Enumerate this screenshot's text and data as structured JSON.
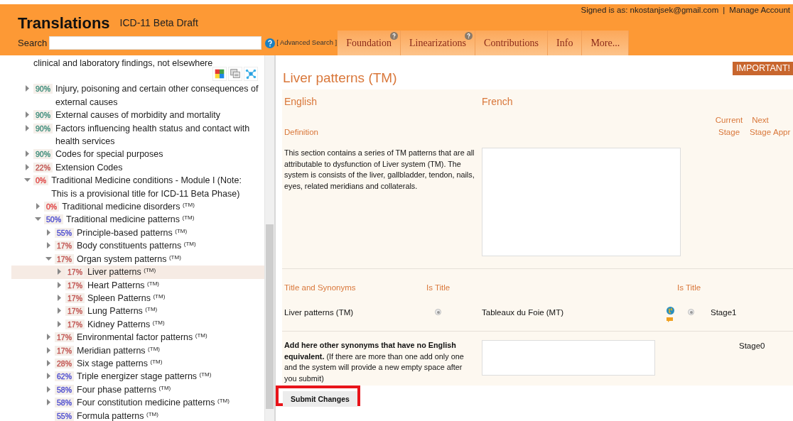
{
  "header": {
    "title": "Translations",
    "subtitle": "ICD-11 Beta Draft",
    "signed_in": "Signed is as: nkostanjsek@gmail.com",
    "separator": "|",
    "manage_account": "Manage Account",
    "search_label": "Search",
    "advanced_search": "[ Advanced Search ]",
    "tabs": [
      {
        "label": "Foundation",
        "help": true
      },
      {
        "label": "Linearizations",
        "help": true
      },
      {
        "label": "Contributions",
        "help": false
      },
      {
        "label": "Info",
        "help": false
      },
      {
        "label": "More...",
        "help": false
      }
    ]
  },
  "tree": {
    "top_fragment": "clinical and laboratory findings, not elsewhere",
    "items": [
      {
        "kind": "node",
        "expanded": false,
        "selected": false,
        "percent": "90%",
        "color": "#3c8c7a",
        "label": "Injury, poisoning and certain other consequences of external causes"
      },
      {
        "kind": "node",
        "expanded": false,
        "selected": false,
        "percent": "90%",
        "color": "#3c8c7a",
        "label": "External causes of morbidity and mortality"
      },
      {
        "kind": "node",
        "expanded": false,
        "selected": false,
        "percent": "90%",
        "color": "#3c8c7a",
        "label": "Factors influencing health status and contact with health services"
      },
      {
        "kind": "node",
        "expanded": false,
        "selected": false,
        "percent": "90%",
        "color": "#3c8c7a",
        "label": "Codes for special purposes"
      },
      {
        "kind": "node",
        "expanded": false,
        "selected": false,
        "percent": "22%",
        "color": "#c0504d",
        "label": "Extension Codes"
      },
      {
        "kind": "node",
        "expanded": true,
        "selected": false,
        "percent": "0%",
        "color": "#e04040",
        "label": "Traditional Medicine conditions - Module I (Note: This is a provisional title for ICD-11 Beta Phase)",
        "children": [
          {
            "kind": "node",
            "expanded": false,
            "selected": false,
            "percent": "0%",
            "color": "#e04040",
            "label": "Traditional medicine disorders $^{(TM)}$"
          },
          {
            "kind": "node",
            "expanded": true,
            "selected": false,
            "percent": "50%",
            "color": "#4a4ad0",
            "label": "Traditional medicine patterns $^{(TM)}$",
            "children": [
              {
                "kind": "node",
                "expanded": false,
                "selected": false,
                "percent": "55%",
                "color": "#4a4ad0",
                "label": "Principle-based patterns $^{(TM)}$"
              },
              {
                "kind": "node",
                "expanded": false,
                "selected": false,
                "percent": "17%",
                "color": "#c0504d",
                "label": "Body constituents patterns $^{(TM)}$"
              },
              {
                "kind": "node",
                "expanded": true,
                "selected": false,
                "percent": "17%",
                "color": "#c0504d",
                "label": "Organ system patterns $^{(TM)}$",
                "children": [
                  {
                    "kind": "node",
                    "expanded": false,
                    "selected": true,
                    "percent": "17%",
                    "color": "#c0504d",
                    "label": "Liver patterns $^{(TM)}$"
                  },
                  {
                    "kind": "node",
                    "expanded": false,
                    "selected": false,
                    "percent": "17%",
                    "color": "#c0504d",
                    "label": "Heart Patterns $^{(TM)}$"
                  },
                  {
                    "kind": "node",
                    "expanded": false,
                    "selected": false,
                    "percent": "17%",
                    "color": "#c0504d",
                    "label": "Spleen Patterns $^{(TM)}$"
                  },
                  {
                    "kind": "node",
                    "expanded": false,
                    "selected": false,
                    "percent": "17%",
                    "color": "#c0504d",
                    "label": "Lung Patterns $^{(TM)}$"
                  },
                  {
                    "kind": "node",
                    "expanded": false,
                    "selected": false,
                    "percent": "17%",
                    "color": "#c0504d",
                    "label": "Kidney Patterns $^{(TM)}$"
                  }
                ]
              },
              {
                "kind": "node",
                "expanded": false,
                "selected": false,
                "percent": "17%",
                "color": "#c0504d",
                "label": "Environmental factor patterns $^{(TM)}$"
              },
              {
                "kind": "node",
                "expanded": false,
                "selected": false,
                "percent": "17%",
                "color": "#c0504d",
                "label": "Meridian patterns $^{(TM)}$"
              },
              {
                "kind": "node",
                "expanded": false,
                "selected": false,
                "percent": "28%",
                "color": "#c0504d",
                "label": "Six stage patterns $^{(TM)}$"
              },
              {
                "kind": "node",
                "expanded": false,
                "selected": false,
                "percent": "62%",
                "color": "#4a4ad0",
                "label": "Triple energizer stage patterns $^{(TM)}$"
              },
              {
                "kind": "node",
                "expanded": false,
                "selected": false,
                "percent": "58%",
                "color": "#4a4ad0",
                "label": "Four phase patterns $^{(TM)}$"
              },
              {
                "kind": "node",
                "expanded": false,
                "selected": false,
                "percent": "58%",
                "color": "#4a4ad0",
                "label": "Four constitution medicine patterns $^{(TM)}$"
              },
              {
                "kind": "leaf",
                "selected": false,
                "percent": "55%",
                "color": "#4a4ad0",
                "label": "Formula patterns $^{(TM)}$"
              }
            ]
          }
        ]
      }
    ]
  },
  "detail": {
    "title": "Liver patterns (TM)",
    "important": "IMPORTANT!",
    "source_language": "English",
    "target_language": "French",
    "definition_label": "Definition",
    "current_stage": "Current Stage",
    "next_stage": "Next Stage",
    "column_8": "Appr",
    "definition_text": "This section contains a series of TM patterns that are all attributable to dysfunction of Liver system (TM). The system is consists of the liver, gallbladder, tendon, nails, eyes, related meridians and collaterals.",
    "synonyms_label": "Title and Synonyms",
    "is_title_label": "Is Title",
    "target_is_title_label": "Is Title",
    "synonyms": [
      {
        "source": "Liver patterns (TM)",
        "source_is_title": true,
        "target": "Tableaux du Foie (MT)",
        "target_is_title": true,
        "stage": "Stage1"
      }
    ],
    "add_note": "**Add here other synonyms that have no English equivalent.** (If there are more than one add only one and the system will provide a new empty space after you submit)",
    "add_stage": "Stage0",
    "submit": "Submit Changes"
  }
}
